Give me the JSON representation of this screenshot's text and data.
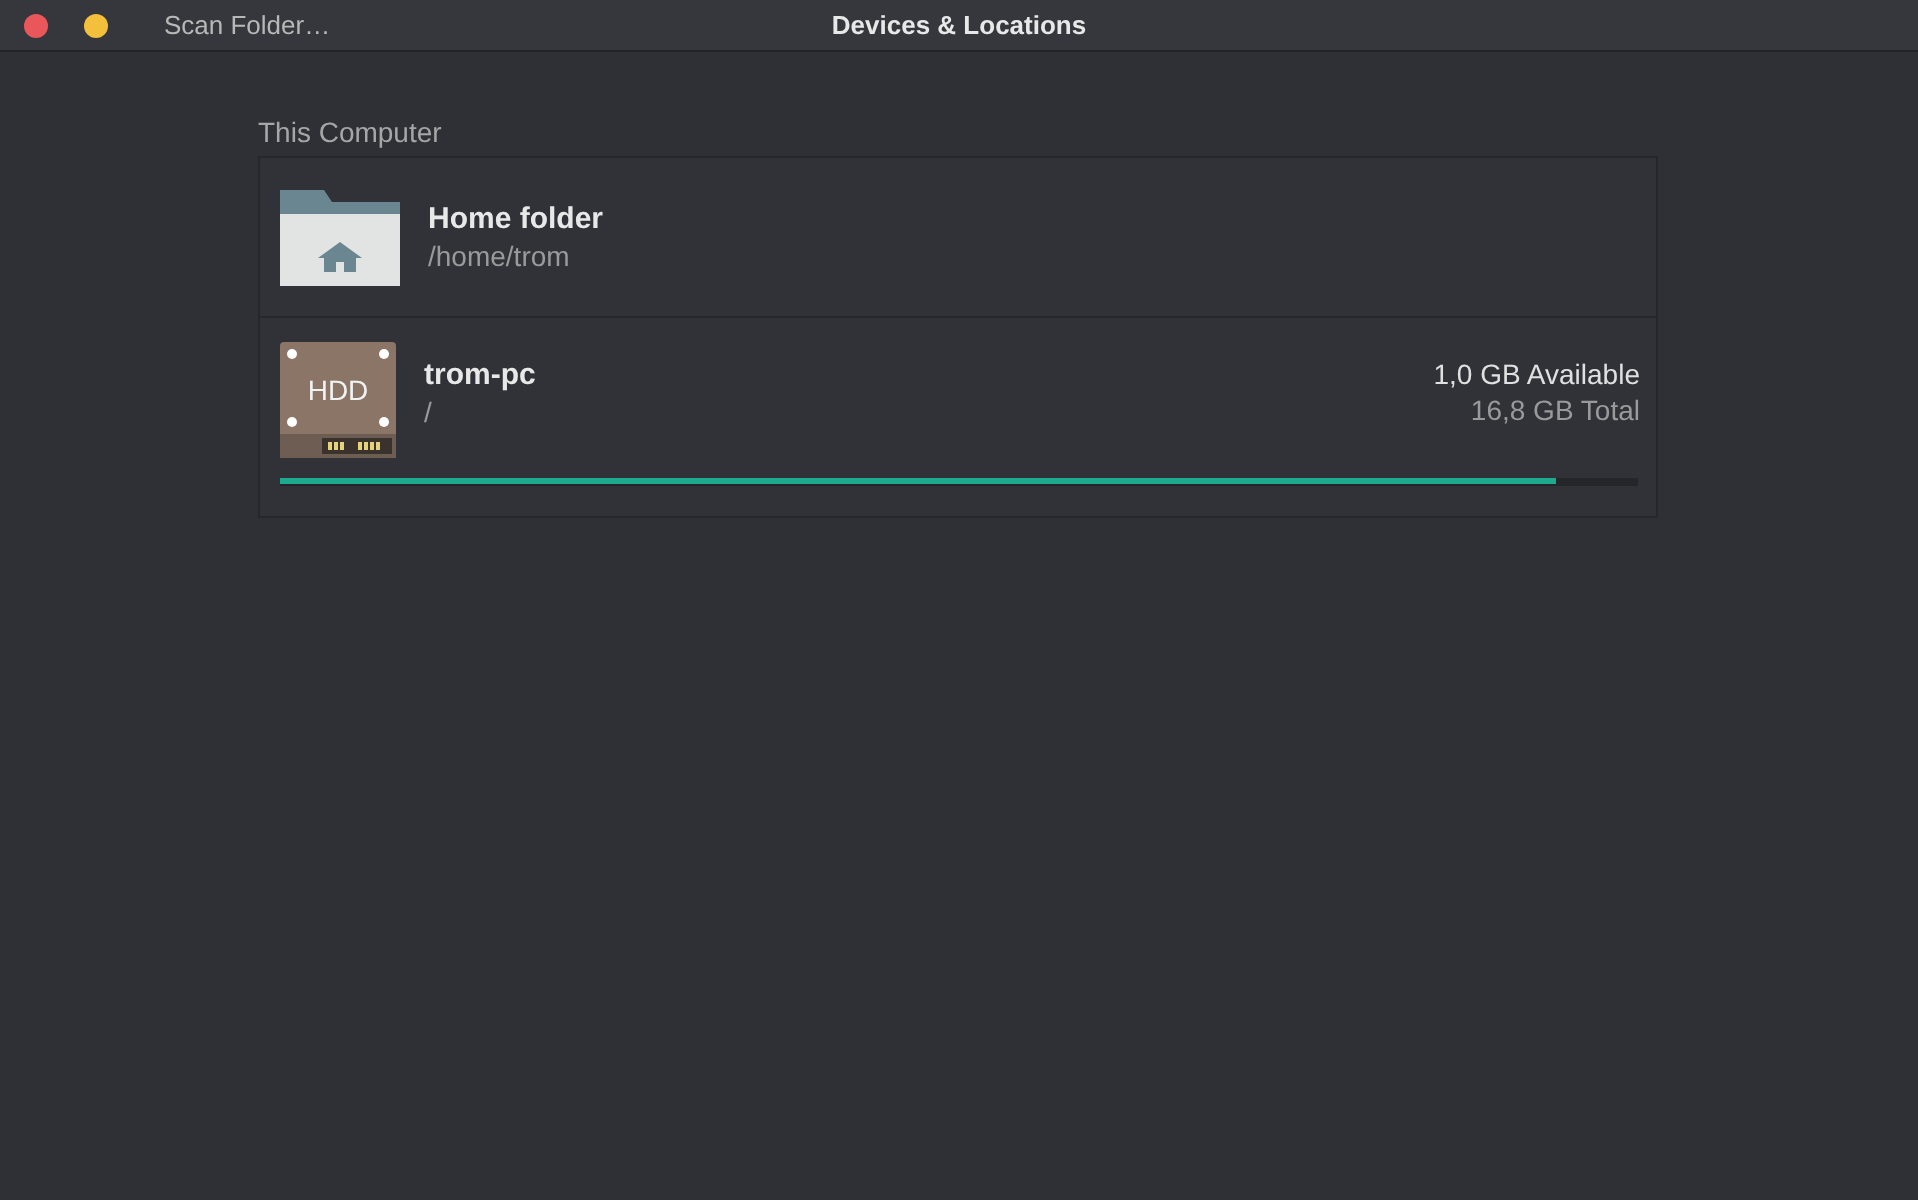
{
  "window": {
    "title": "Devices & Locations",
    "controls": [
      {
        "kind": "close"
      },
      {
        "kind": "minimize"
      }
    ]
  },
  "header": {
    "button": "Scan Folder…"
  },
  "section": {
    "title": "This Computer",
    "items": [
      {
        "kind": "folder",
        "name": "Home folder",
        "path": "/home/trom"
      },
      {
        "kind": "disk",
        "name": "trom-pc",
        "path": "/",
        "icon_label": "HDD",
        "available": "1,0 GB Available",
        "total": "16,8 GB Total",
        "level": 0.94
      }
    ]
  }
}
